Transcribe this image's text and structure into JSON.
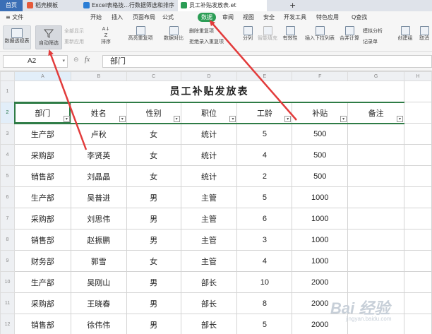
{
  "tabs": [
    {
      "label": "首页",
      "color": "#e6553a"
    },
    {
      "label": "稻壳模板",
      "color": "#e65a3a"
    },
    {
      "label": "Excel表格技...行数据筛选和排序",
      "color": "#2a7dd5"
    },
    {
      "label": "员工补贴发放表.et",
      "color": "#2b9d55"
    }
  ],
  "new_tab": "+",
  "menu": {
    "file": "≡ 文件",
    "items": [
      "开始",
      "插入",
      "页面布局",
      "公式",
      "数据",
      "审阅",
      "视图",
      "安全",
      "开发工具",
      "特色应用"
    ],
    "active": "数据",
    "search": "Q查找"
  },
  "ribbon": {
    "pivot": "数据透视表",
    "autofilter": "自动筛选",
    "show_all": "全部显示",
    "reapply": "重新应用",
    "sort": "排序",
    "highlight_dup": "高亮重复项",
    "data_compare": "数据对比",
    "delete_dup": "删除重复项",
    "reject_dup": "拒绝录入重复项",
    "split": "分列",
    "smart_fill": "智能填充",
    "validity": "有效性",
    "dropdown_list": "插入下拉列表",
    "consolidate": "合并计算",
    "simulation": "模拟分析",
    "record": "记录单",
    "group": "创建组",
    "ungroup": "取消"
  },
  "name_box": "A2",
  "fx": "fx",
  "formula_value": "部门",
  "columns": [
    "A",
    "B",
    "C",
    "D",
    "E",
    "F",
    "G",
    "H"
  ],
  "title": "员工补贴发放表",
  "headers": [
    "部门",
    "姓名",
    "性别",
    "职位",
    "工龄",
    "补贴",
    "备注"
  ],
  "rows": [
    [
      "生产部",
      "卢秋",
      "女",
      "统计",
      "5",
      "500"
    ],
    [
      "采购部",
      "李贤英",
      "女",
      "统计",
      "4",
      "500"
    ],
    [
      "销售部",
      "刘晶晶",
      "女",
      "统计",
      "2",
      "500"
    ],
    [
      "生产部",
      "吴普进",
      "男",
      "主管",
      "5",
      "1000"
    ],
    [
      "采购部",
      "刘思伟",
      "男",
      "主管",
      "6",
      "1000"
    ],
    [
      "销售部",
      "赵振鹏",
      "男",
      "主管",
      "3",
      "1000"
    ],
    [
      "财务部",
      "郭雪",
      "女",
      "主管",
      "4",
      "1000"
    ],
    [
      "生产部",
      "吴刚山",
      "男",
      "部长",
      "10",
      "2000"
    ],
    [
      "采购部",
      "王晓春",
      "男",
      "部长",
      "8",
      "2000"
    ],
    [
      "销售部",
      "徐伟伟",
      "男",
      "部长",
      "5",
      "2000"
    ]
  ],
  "row_numbers": [
    "1",
    "2",
    "3",
    "4",
    "5",
    "6",
    "7",
    "8",
    "9",
    "10",
    "11",
    "12"
  ],
  "watermark": "Bai 经验",
  "watermark_sub": "jingyan.baidu.com",
  "colors": {
    "accent_green": "#2f7c46",
    "arrow_red": "#e23b3b"
  }
}
